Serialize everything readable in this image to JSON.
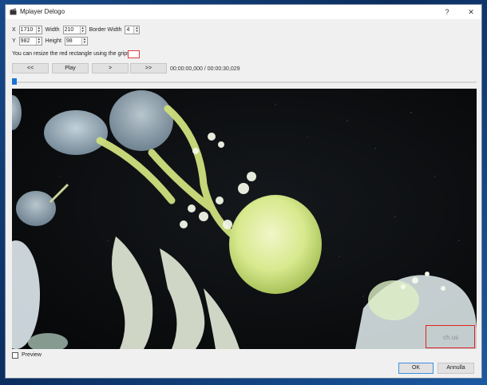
{
  "window": {
    "title": "Mplayer Delogo",
    "help_glyph": "?",
    "close_glyph": "✕"
  },
  "fields": {
    "x": {
      "label": "X",
      "value": "1710"
    },
    "width": {
      "label": "Width",
      "value": "210"
    },
    "border_width": {
      "label": "Border Width",
      "value": "4"
    },
    "y": {
      "label": "Y",
      "value": "982"
    },
    "height": {
      "label": "Height",
      "value": "98"
    }
  },
  "info_text": "You can resize the red rectangle using the grips",
  "controls": {
    "rewind_label": "<<",
    "play_label": "Play",
    "step_label": ">",
    "forward_label": ">>",
    "timecode": "00:00:00,000 / 00:00:30,029"
  },
  "seek": {
    "position": 0.0
  },
  "video": {
    "watermark": "ch.us"
  },
  "preview": {
    "label": "Preview",
    "checked": false
  },
  "buttons": {
    "ok_label": "OK",
    "cancel_label": "Annulla"
  },
  "colors": {
    "accent": "#1b74d3",
    "logo_rect": "#e02020",
    "jelly": "#cfe78a"
  },
  "icons": {
    "app": "clapperboard-icon",
    "help": "help-icon",
    "close": "close-icon"
  }
}
